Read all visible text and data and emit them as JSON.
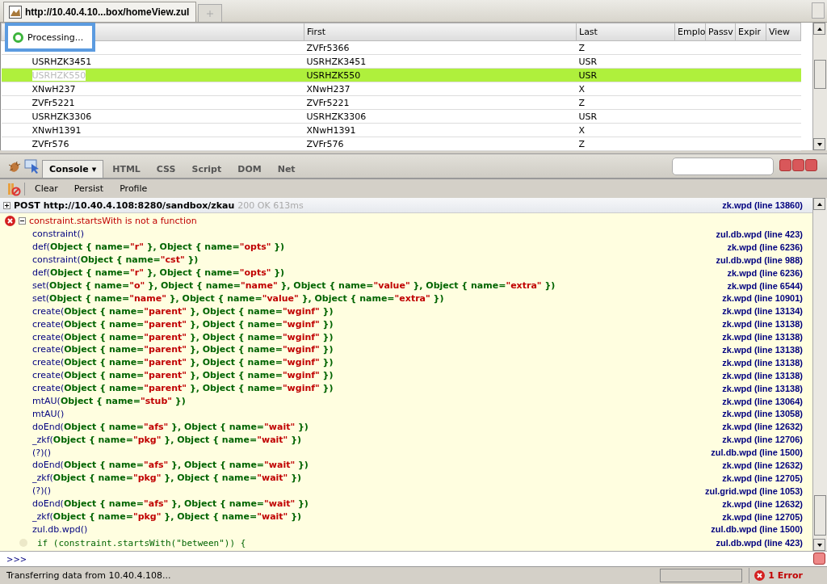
{
  "browser_tab": {
    "title": "http://10.40.4.10...box/homeView.zul"
  },
  "processing": {
    "label": "Processing..."
  },
  "table": {
    "columns": [
      {},
      {
        "label": "First"
      },
      {
        "label": "Last"
      },
      {
        "label": "Emplo"
      },
      {
        "label": "Passv"
      },
      {
        "label": "Expir"
      },
      {
        "label": "View"
      }
    ],
    "rows": [
      {
        "cells": [
          null,
          "ZVFr5366",
          "Z"
        ],
        "selected": false
      },
      {
        "cells": [
          "USRHZK3451",
          "USRHZK3451",
          "USR"
        ],
        "selected": false
      },
      {
        "cells": [
          "USRHZK550",
          "USRHZK550",
          "USR"
        ],
        "selected": true
      },
      {
        "cells": [
          "XNwH237",
          "XNwH237",
          "X"
        ],
        "selected": false
      },
      {
        "cells": [
          "ZVFr5221",
          "ZVFr5221",
          "Z"
        ],
        "selected": false
      },
      {
        "cells": [
          "USRHZK3306",
          "USRHZK3306",
          "USR"
        ],
        "selected": false
      },
      {
        "cells": [
          "XNwH1391",
          "XNwH1391",
          "X"
        ],
        "selected": false
      },
      {
        "cells": [
          "ZVFr576",
          "ZVFr576",
          "Z"
        ],
        "selected": false
      }
    ]
  },
  "firebug": {
    "tabs": [
      {
        "label": "Console",
        "menu": "▾",
        "selected": true
      },
      {
        "label": "HTML",
        "selected": false
      },
      {
        "label": "CSS",
        "selected": false
      },
      {
        "label": "Script",
        "selected": false
      },
      {
        "label": "DOM",
        "selected": false
      },
      {
        "label": "Net",
        "selected": false
      }
    ],
    "console_buttons": [
      "Clear",
      "Persist",
      "Profile"
    ],
    "request": {
      "method": "POST",
      "url": "http://10.40.4.108:8280/sandbox/zkau",
      "status": "200 OK 613ms",
      "source": "zk.wpd (line 13860)"
    },
    "error": {
      "message": "constraint.startsWith is not a function",
      "expanded": true
    },
    "frames": [
      {
        "fn": "constraint()",
        "source": "zul.db.wpd (line 423)"
      },
      {
        "fn": "def(",
        "parts": [
          "Object { name=",
          "\"r\"",
          " }, Object { name=",
          "\"opts\"",
          " })"
        ],
        "source": "zk.wpd (line 6236)"
      },
      {
        "fn": "constraint(",
        "parts": [
          "Object { name=",
          "\"cst\"",
          " })"
        ],
        "source": "zul.db.wpd (line 988)"
      },
      {
        "fn": "def(",
        "parts": [
          "Object { name=",
          "\"r\"",
          " }, Object { name=",
          "\"opts\"",
          " })"
        ],
        "source": "zk.wpd (line 6236)"
      },
      {
        "fn": "set(",
        "parts": [
          "Object { name=",
          "\"o\"",
          " }, Object { name=",
          "\"name\"",
          " }, Object { name=",
          "\"value\"",
          " }, Object { name=",
          "\"extra\"",
          " })"
        ],
        "source": "zk.wpd (line 6544)"
      },
      {
        "fn": "set(",
        "parts": [
          "Object { name=",
          "\"name\"",
          " }, Object { name=",
          "\"value\"",
          " }, Object { name=",
          "\"extra\"",
          " })"
        ],
        "source": "zk.wpd (line 10901)"
      },
      {
        "fn": "create(",
        "parts": [
          "Object { name=",
          "\"parent\"",
          " }, Object { name=",
          "\"wginf\"",
          " })"
        ],
        "source": "zk.wpd (line 13134)"
      },
      {
        "fn": "create(",
        "parts": [
          "Object { name=",
          "\"parent\"",
          " }, Object { name=",
          "\"wginf\"",
          " })"
        ],
        "source": "zk.wpd (line 13138)"
      },
      {
        "fn": "create(",
        "parts": [
          "Object { name=",
          "\"parent\"",
          " }, Object { name=",
          "\"wginf\"",
          " })"
        ],
        "source": "zk.wpd (line 13138)"
      },
      {
        "fn": "create(",
        "parts": [
          "Object { name=",
          "\"parent\"",
          " }, Object { name=",
          "\"wginf\"",
          " })"
        ],
        "source": "zk.wpd (line 13138)"
      },
      {
        "fn": "create(",
        "parts": [
          "Object { name=",
          "\"parent\"",
          " }, Object { name=",
          "\"wginf\"",
          " })"
        ],
        "source": "zk.wpd (line 13138)"
      },
      {
        "fn": "create(",
        "parts": [
          "Object { name=",
          "\"parent\"",
          " }, Object { name=",
          "\"wginf\"",
          " })"
        ],
        "source": "zk.wpd (line 13138)"
      },
      {
        "fn": "create(",
        "parts": [
          "Object { name=",
          "\"parent\"",
          " }, Object { name=",
          "\"wginf\"",
          " })"
        ],
        "source": "zk.wpd (line 13138)"
      },
      {
        "fn": "mtAU(",
        "parts": [
          "Object { name=",
          "\"stub\"",
          " })"
        ],
        "source": "zk.wpd (line 13064)"
      },
      {
        "fn": "mtAU()",
        "source": "zk.wpd (line 13058)"
      },
      {
        "fn": "doEnd(",
        "parts": [
          "Object { name=",
          "\"afs\"",
          " }, Object { name=",
          "\"wait\"",
          " })"
        ],
        "source": "zk.wpd (line 12632)"
      },
      {
        "fn": "_zkf(",
        "parts": [
          "Object { name=",
          "\"pkg\"",
          " }, Object { name=",
          "\"wait\"",
          " })"
        ],
        "source": "zk.wpd (line 12706)"
      },
      {
        "fn": "(?)()",
        "source": "zul.db.wpd (line 1500)"
      },
      {
        "fn": "doEnd(",
        "parts": [
          "Object { name=",
          "\"afs\"",
          " }, Object { name=",
          "\"wait\"",
          " })"
        ],
        "source": "zk.wpd (line 12632)"
      },
      {
        "fn": "_zkf(",
        "parts": [
          "Object { name=",
          "\"pkg\"",
          " }, Object { name=",
          "\"wait\"",
          " })"
        ],
        "source": "zk.wpd (line 12705)"
      },
      {
        "fn": "(?)()",
        "source": "zul.grid.wpd (line 1053)"
      },
      {
        "fn": "doEnd(",
        "parts": [
          "Object { name=",
          "\"afs\"",
          " }, Object { name=",
          "\"wait\"",
          " })"
        ],
        "source": "zk.wpd (line 12632)"
      },
      {
        "fn": "_zkf(",
        "parts": [
          "Object { name=",
          "\"pkg\"",
          " }, Object { name=",
          "\"wait\"",
          " })"
        ],
        "source": "zk.wpd (line 12705)"
      },
      {
        "fn": "zul.db.wpd()",
        "source": "zul.db.wpd (line 1500)"
      }
    ],
    "source_line": {
      "code": "if (constraint.startsWith(\"between\")) {",
      "source": "zul.db.wpd (line 423)"
    },
    "command_prompt": ">>>"
  },
  "status_bar": {
    "text": "Transferring data from 10.40.4.108...",
    "errors": "1 Error"
  }
}
